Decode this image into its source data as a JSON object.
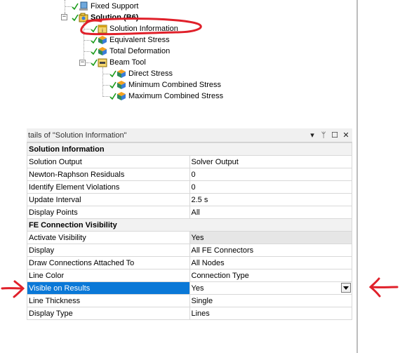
{
  "tree": {
    "items": [
      {
        "label": "Fixed Support"
      },
      {
        "label": "Solution (B6)"
      },
      {
        "label": "Solution Information"
      },
      {
        "label": "Equivalent Stress"
      },
      {
        "label": "Total Deformation"
      },
      {
        "label": "Beam Tool"
      },
      {
        "label": "Direct Stress"
      },
      {
        "label": "Minimum Combined Stress"
      },
      {
        "label": "Maximum Combined Stress"
      }
    ]
  },
  "details": {
    "title": "tails of \"Solution Information\"",
    "header_buttons": [
      "▾",
      "ᛘ",
      "☐",
      "✕"
    ],
    "groups": [
      {
        "name": "Solution Information",
        "rows": [
          {
            "key": "Solution Output",
            "value": "Solver Output"
          },
          {
            "key": "Newton-Raphson Residuals",
            "value": "0"
          },
          {
            "key": "Identify Element Violations",
            "value": "0"
          },
          {
            "key": "Update Interval",
            "value": "2.5 s"
          },
          {
            "key": "Display Points",
            "value": "All"
          }
        ]
      },
      {
        "name": "FE Connection Visibility",
        "rows": [
          {
            "key": "Activate Visibility",
            "value": "Yes"
          },
          {
            "key": "Display",
            "value": "All FE Connectors"
          },
          {
            "key": "Draw Connections Attached To",
            "value": "All Nodes"
          },
          {
            "key": "Line Color",
            "value": "Connection Type"
          },
          {
            "key": "Visible on Results",
            "value": "Yes"
          },
          {
            "key": "Line Thickness",
            "value": "Single"
          },
          {
            "key": "Display Type",
            "value": "Lines"
          }
        ]
      }
    ]
  },
  "colors": {
    "selection": "#0a78d7",
    "annotation": "#e0202a",
    "check": "#1a9c1a"
  }
}
